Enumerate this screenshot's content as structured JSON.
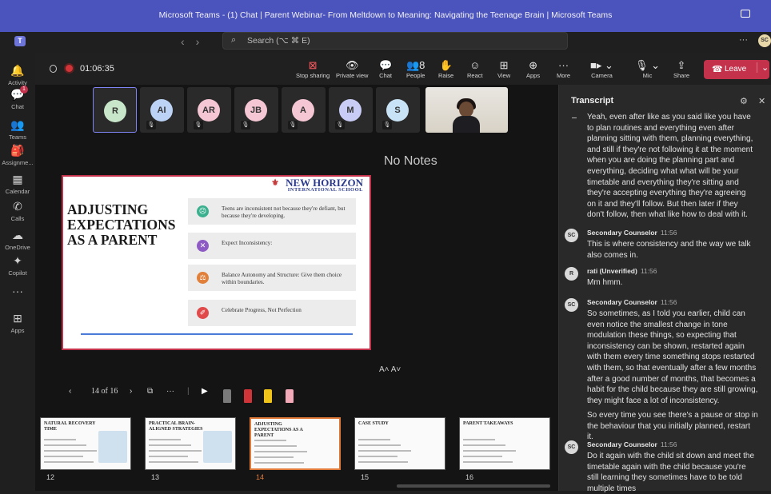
{
  "window": {
    "title": "Microsoft Teams - (1) Chat | Parent Webinar- From Meltdown to Meaning: Navigating the Teenage Brain | Microsoft Teams"
  },
  "topbar": {
    "search_placeholder": "Search (⌥ ⌘ E)",
    "more": "···",
    "avatar": "SC"
  },
  "rail": [
    {
      "label": "Activity",
      "icon": "bell-icon",
      "glyph": "🔔"
    },
    {
      "label": "Chat",
      "icon": "chat-icon",
      "glyph": "💬",
      "badge": "1"
    },
    {
      "label": "Teams",
      "icon": "teams-icon",
      "glyph": "👥"
    },
    {
      "label": "Assignme...",
      "icon": "assignment-icon",
      "glyph": "🎒"
    },
    {
      "label": "Calendar",
      "icon": "calendar-icon",
      "glyph": "▦"
    },
    {
      "label": "Calls",
      "icon": "phone-icon",
      "glyph": "✆"
    },
    {
      "label": "OneDrive",
      "icon": "cloud-icon",
      "glyph": "☁"
    },
    {
      "label": "Copilot",
      "icon": "copilot-icon",
      "glyph": "✦"
    },
    {
      "label": "",
      "icon": "more-icon",
      "glyph": "···"
    },
    {
      "label": "Apps",
      "icon": "apps-icon",
      "glyph": "⊞"
    }
  ],
  "call": {
    "timer": "01:06:35",
    "controls": [
      {
        "label": "Stop sharing",
        "icon": "stop-share-icon",
        "glyph": "⊠"
      },
      {
        "label": "Private view",
        "icon": "eye-icon",
        "glyph": "👁"
      },
      {
        "label": "Chat",
        "icon": "chat-icon",
        "glyph": "💬"
      },
      {
        "label": "People",
        "icon": "people-icon",
        "glyph": "👥8"
      },
      {
        "label": "Raise",
        "icon": "hand-icon",
        "glyph": "✋"
      },
      {
        "label": "React",
        "icon": "smile-icon",
        "glyph": "☺"
      },
      {
        "label": "View",
        "icon": "grid-icon",
        "glyph": "⊞"
      },
      {
        "label": "Apps",
        "icon": "plus-icon",
        "glyph": "⊕"
      },
      {
        "label": "More",
        "icon": "more-icon",
        "glyph": "···"
      },
      {
        "label": "Camera",
        "icon": "camera-icon",
        "glyph": "■▸ ⌄"
      },
      {
        "label": "Mic",
        "icon": "mic-icon",
        "glyph": "🎙 ⌄"
      },
      {
        "label": "Share",
        "icon": "share-icon",
        "glyph": "⇪"
      }
    ],
    "leave": "Leave"
  },
  "participants": [
    {
      "initials": "R",
      "color": "#c8e6c9",
      "selected": true
    },
    {
      "initials": "AI",
      "color": "#bcd3f5",
      "muted": true
    },
    {
      "initials": "AR",
      "color": "#f5c6d4",
      "muted": true
    },
    {
      "initials": "JB",
      "color": "#f5c6d4",
      "muted": true
    },
    {
      "initials": "A",
      "color": "#f5c6d4",
      "muted": true
    },
    {
      "initials": "M",
      "color": "#c9cdf5",
      "muted": true
    },
    {
      "initials": "S",
      "color": "#c8e3f5",
      "muted": true
    }
  ],
  "stage": {
    "no_notes": "No Notes",
    "font_controls": "A˄  A˅"
  },
  "slide": {
    "school_name": "NEW HORIZON",
    "school_sub": "INTERNATIONAL SCHOOL",
    "title": "ADJUSTING EXPECTATIONS AS A PARENT",
    "points": [
      {
        "text": "Teens are inconsistent not because they're defiant, but because they're developing.",
        "color": "#3bb08f",
        "glyph": "☹"
      },
      {
        "text": "Expect Inconsistency:",
        "color": "#8e5bc4",
        "glyph": "✕"
      },
      {
        "text": "Balance Autonomy and Structure: Give them choice within boundaries.",
        "color": "#e0803a",
        "glyph": "⚖"
      },
      {
        "text": "Celebrate Progress, Not Perfection",
        "color": "#e04a4a",
        "glyph": "✐"
      }
    ]
  },
  "slidebar": {
    "prev": "‹",
    "counter": "14 of 16",
    "next": "›",
    "grid": "⧉",
    "more": "···"
  },
  "thumbnails": [
    {
      "num": "12",
      "title": "NATURAL RECOVERY TIME",
      "current": false
    },
    {
      "num": "13",
      "title": "PRACTICAL BRAIN-ALIGNED STRATEGIES",
      "current": false
    },
    {
      "num": "14",
      "title": "ADJUSTING EXPECTATIONS AS A PARENT",
      "current": true
    },
    {
      "num": "15",
      "title": "CASE STUDY",
      "current": false
    },
    {
      "num": "16",
      "title": "PARENT TAKEAWAYS",
      "current": false
    }
  ],
  "transcript": {
    "title": "Transcript",
    "lead_text": "Yeah, even after like as you said like you have to plan routines and everything even after planning sitting with them, planning everything, and still if they're not following it at the moment when you are doing the planning part and everything, deciding what what will be your timetable and everything they're sitting and they're accepting everything they're agreeing on it and they'll follow. But then later if they don't follow, then what like how to deal with it.",
    "entries": [
      {
        "avatar": "SC",
        "name": "Secondary Counselor",
        "time": "11:56",
        "text": "This is where consistency and the way we talk also comes in."
      },
      {
        "avatar": "R",
        "name": "rati (Unverified)",
        "time": "11:56",
        "text": "Mm hmm."
      },
      {
        "avatar": "SC",
        "name": "Secondary Counselor",
        "time": "11:56",
        "text": "So sometimes, as I told you earlier, child can even notice the smallest change in tone modulation these things, so expecting that inconsistency can be shown, restarted again with them every time something stops restarted with them, so that eventually after a few months after a good number of months, that becomes a habit for the child because they are still growing, they might face a lot of inconsistency.",
        "extra": "So every time you see there's a pause or stop in the behaviour that you initially planned, restart it."
      },
      {
        "avatar": "SC",
        "name": "Secondary Counselor",
        "time": "11:56",
        "text": "Do it again with the child sit down and meet the timetable again with the child because you're still learning they sometimes have to be told multiple times"
      }
    ]
  }
}
